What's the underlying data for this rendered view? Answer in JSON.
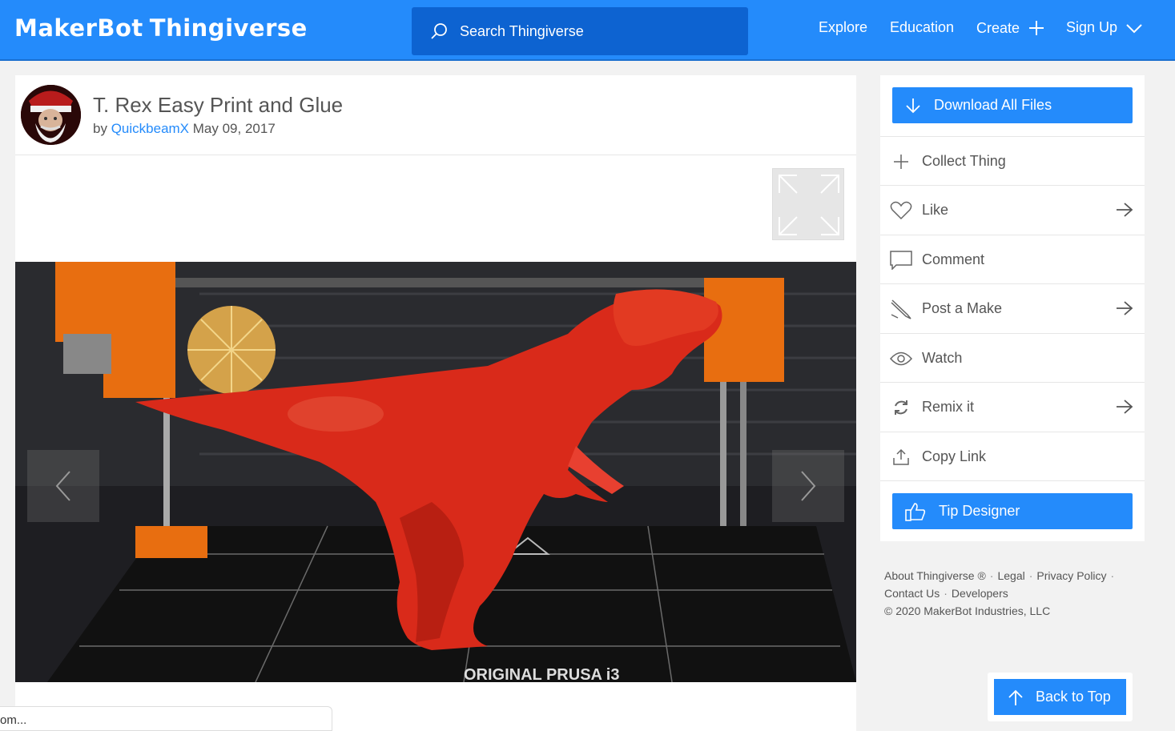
{
  "header": {
    "logo_maker": "MakerBot",
    "logo_thing": "Thingiverse",
    "search_placeholder": "Search Thingiverse",
    "nav": {
      "explore": "Explore",
      "education": "Education",
      "create": "Create",
      "signup": "Sign Up"
    }
  },
  "thing": {
    "title": "T. Rex Easy Print and Glue",
    "by": "by",
    "author": "QuickbeamX",
    "date": "May 09, 2017",
    "bed_text": "ORIGINAL PRUSA i3"
  },
  "actions": {
    "download": "Download All Files",
    "collect": "Collect Thing",
    "like": "Like",
    "comment": "Comment",
    "post_make": "Post a Make",
    "watch": "Watch",
    "remix": "Remix it",
    "copy_link": "Copy Link",
    "tip": "Tip Designer"
  },
  "footer": {
    "about": "About Thingiverse ®",
    "legal": "Legal",
    "privacy": "Privacy Policy",
    "contact": "Contact Us",
    "developers": "Developers",
    "copyright": "©  2020 MakerBot Industries, LLC"
  },
  "back_to_top": "Back to Top",
  "status_text": "om...",
  "colors": {
    "brand_blue": "#248bfb",
    "search_bg": "#0d63d1",
    "page_bg": "#f2f2f2"
  },
  "icons": {
    "search": "search-icon",
    "create": "plus-icon",
    "signup": "chevron-down-icon",
    "download": "download-arrow-icon",
    "collect": "plus-icon",
    "like": "heart-icon",
    "comment": "speech-bubble-icon",
    "post_make": "pencil-icon",
    "watch": "eye-icon",
    "remix": "refresh-icon",
    "copy_link": "share-icon",
    "tip": "thumbs-up-icon",
    "back_to_top": "arrow-up-icon",
    "expand": "expand-icon"
  }
}
